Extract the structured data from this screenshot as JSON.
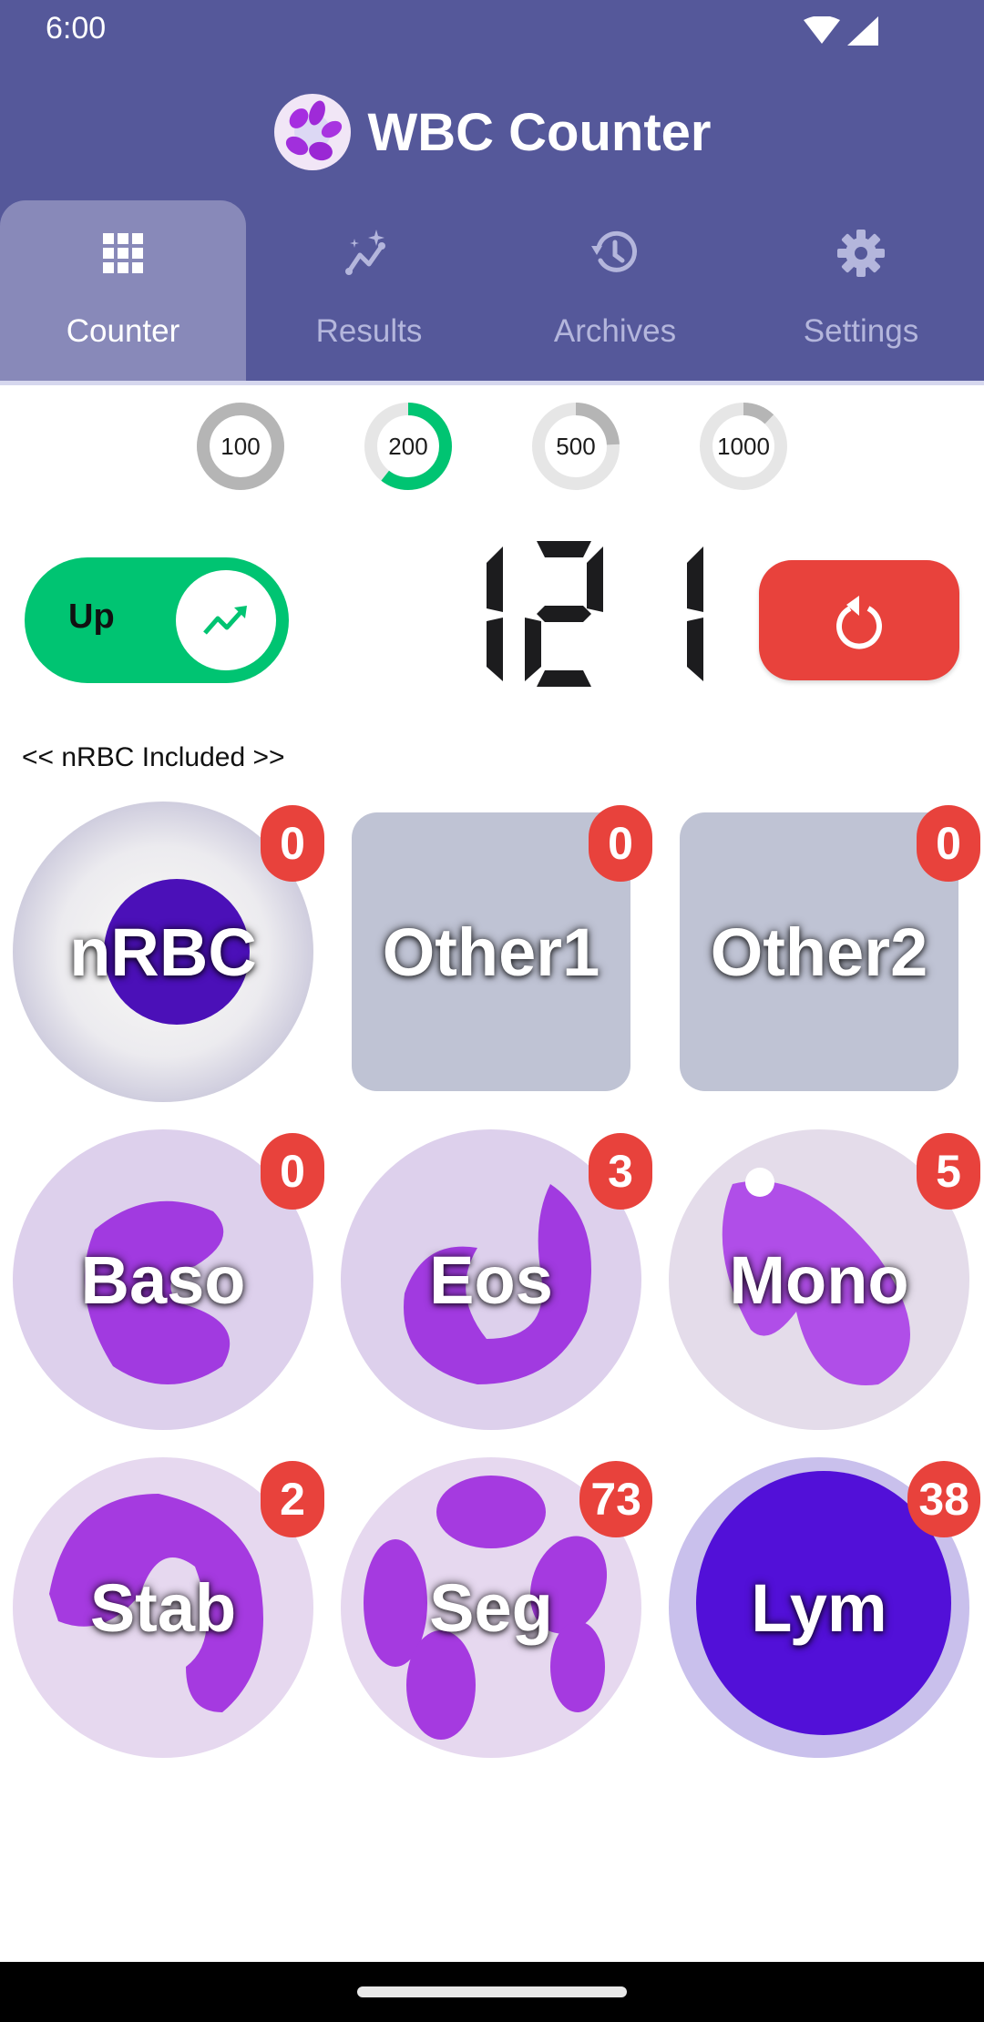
{
  "status_bar": {
    "time": "6:00",
    "icons": [
      "wifi-icon",
      "cellular-signal-icon"
    ]
  },
  "app": {
    "title": "WBC Counter",
    "logo_icon": "neutrophil-cell-logo"
  },
  "tabs": [
    {
      "label": "Counter",
      "icon": "grid-icon",
      "active": true
    },
    {
      "label": "Results",
      "icon": "sparkle-chart-icon",
      "active": false
    },
    {
      "label": "Archives",
      "icon": "history-icon",
      "active": false
    },
    {
      "label": "Settings",
      "icon": "gear-icon",
      "active": false
    }
  ],
  "targets": [
    {
      "label": "100",
      "progress": 1.0,
      "selected": false
    },
    {
      "label": "200",
      "progress": 0.605,
      "selected": true
    },
    {
      "label": "500",
      "progress": 0.242,
      "selected": false
    },
    {
      "label": "1000",
      "progress": 0.121,
      "selected": false
    }
  ],
  "colors": {
    "header": "#55589a",
    "active_tab": "#8889b9",
    "accent_green": "#00c472",
    "badge_red": "#e8423c",
    "ring_done": "#b5b5b5",
    "ring_track": "#e6e6e6"
  },
  "counter": {
    "direction_label": "Up",
    "direction_icon": "trending-up-icon",
    "total": "121",
    "reset_icon": "reset-icon"
  },
  "nrbc_note": "<< nRBC Included >>",
  "cells": [
    {
      "label": "nRBC",
      "count": "0",
      "shape": "nrbc"
    },
    {
      "label": "Other1",
      "count": "0",
      "shape": "square"
    },
    {
      "label": "Other2",
      "count": "0",
      "shape": "square"
    },
    {
      "label": "Baso",
      "count": "0",
      "shape": "baso"
    },
    {
      "label": "Eos",
      "count": "3",
      "shape": "eos"
    },
    {
      "label": "Mono",
      "count": "5",
      "shape": "mono"
    },
    {
      "label": "Stab",
      "count": "2",
      "shape": "stab"
    },
    {
      "label": "Seg",
      "count": "73",
      "shape": "seg"
    },
    {
      "label": "Lym",
      "count": "38",
      "shape": "lym"
    }
  ]
}
